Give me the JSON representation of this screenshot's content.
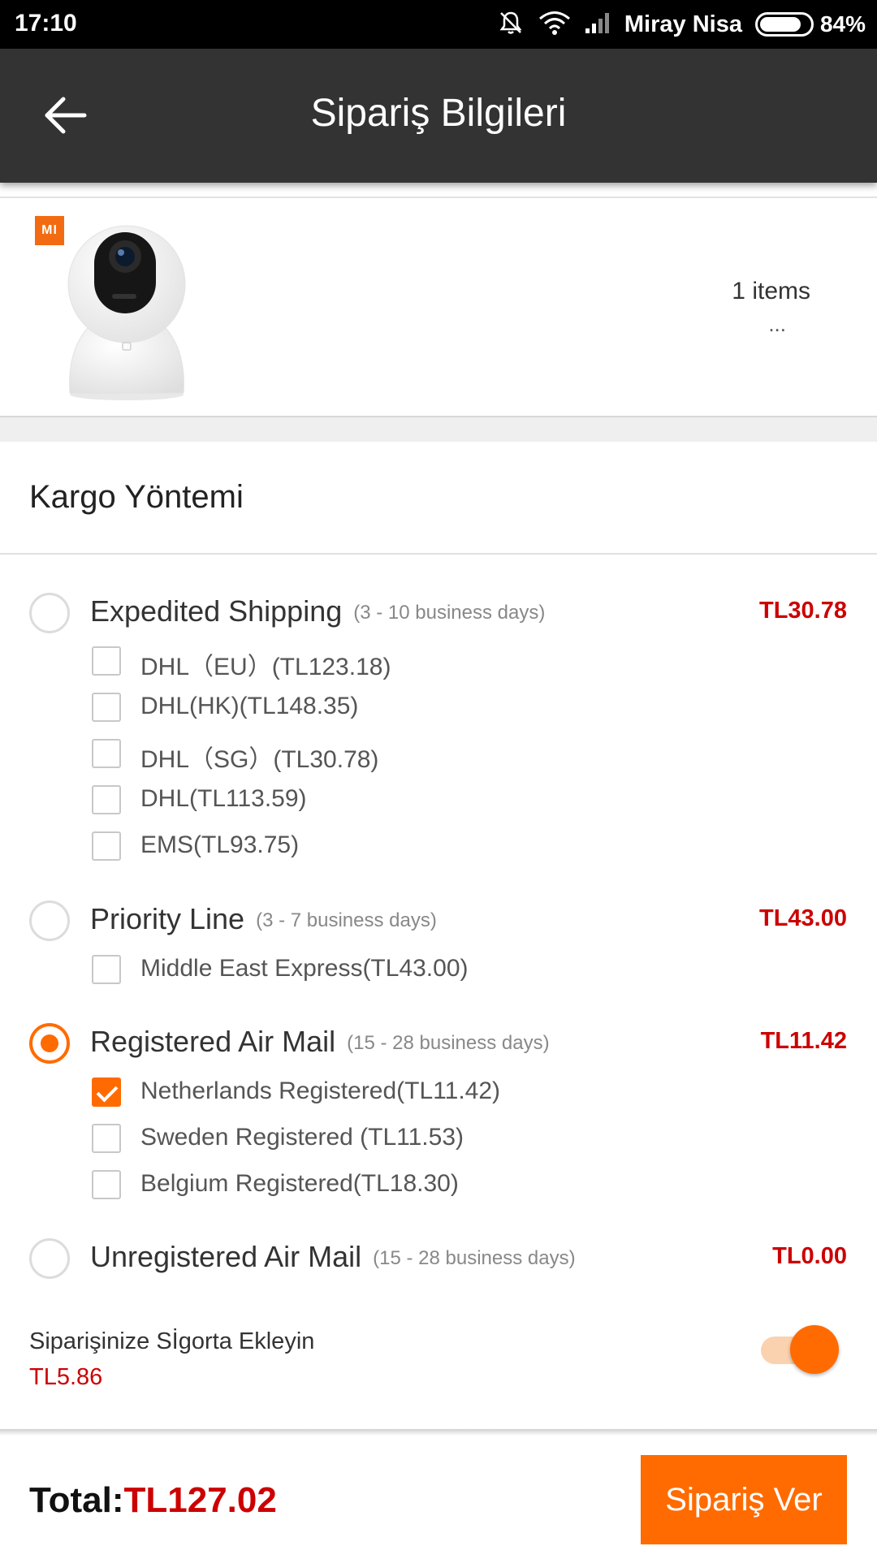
{
  "status_bar": {
    "time": "17:10",
    "carrier": "Miray Nisa",
    "battery": "84%",
    "battery_level": 0.84
  },
  "header": {
    "title": "Sipariş Bilgileri"
  },
  "product": {
    "brand_badge": "MI",
    "items_count": "1 items",
    "more": "..."
  },
  "shipping": {
    "section_title": "Kargo Yöntemi",
    "methods": [
      {
        "name": "Expedited Shipping",
        "days": "(3 - 10 business days)",
        "price": "TL30.78",
        "selected": false,
        "options": [
          {
            "label": "DHL（EU）(TL123.18)",
            "checked": false
          },
          {
            "label": "DHL(HK)(TL148.35)",
            "checked": false
          },
          {
            "label": "DHL（SG）(TL30.78)",
            "checked": false
          },
          {
            "label": "DHL(TL113.59)",
            "checked": false
          },
          {
            "label": "EMS(TL93.75)",
            "checked": false
          }
        ]
      },
      {
        "name": "Priority Line",
        "days": "(3 - 7 business days)",
        "price": "TL43.00",
        "selected": false,
        "options": [
          {
            "label": "Middle East Express(TL43.00)",
            "checked": false
          }
        ]
      },
      {
        "name": "Registered Air Mail",
        "days": "(15 - 28 business days)",
        "price": "TL11.42",
        "selected": true,
        "options": [
          {
            "label": "Netherlands Registered(TL11.42)",
            "checked": true
          },
          {
            "label": "Sweden  Registered (TL11.53)",
            "checked": false
          },
          {
            "label": "Belgium Registered(TL18.30)",
            "checked": false
          }
        ]
      },
      {
        "name": "Unregistered Air Mail",
        "days": "(15 - 28 business days)",
        "price": "TL0.00",
        "selected": false,
        "options": []
      }
    ]
  },
  "insurance": {
    "label": "Siparişinize Sİgorta Ekleyin",
    "price": "TL5.86",
    "enabled": true
  },
  "footer": {
    "total_label": "Total:",
    "total_value": "TL127.02",
    "order_button": "Sipariş Ver"
  },
  "colors": {
    "accent": "#ff6b00",
    "price": "#cc0000",
    "appbar": "#333333"
  }
}
